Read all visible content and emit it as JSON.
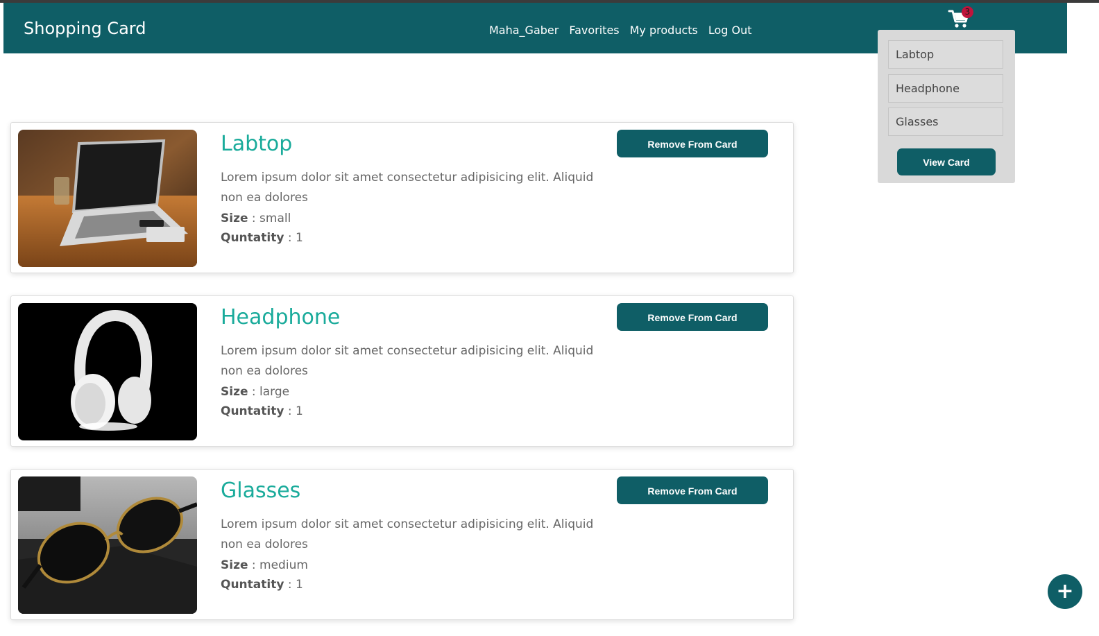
{
  "header": {
    "brand": "Shopping Card",
    "nav": [
      "Maha_Gaber",
      "Favorites",
      "My products",
      "Log Out"
    ],
    "cart_count": "3"
  },
  "cart_dropdown": {
    "items": [
      "Labtop",
      "Headphone",
      "Glasses"
    ],
    "view_card_label": "View Card"
  },
  "products": [
    {
      "title": "Labtop",
      "description": "Lorem ipsum dolor sit amet consectetur adipisicing elit. Aliquid non ea dolores",
      "size_label": "Size",
      "size": " : small",
      "quantity_label": "Quntatity",
      "quantity": " : 1",
      "remove_label": "Remove From Card"
    },
    {
      "title": "Headphone",
      "description": "Lorem ipsum dolor sit amet consectetur adipisicing elit. Aliquid non ea dolores",
      "size_label": "Size",
      "size": " : large",
      "quantity_label": "Quntatity",
      "quantity": " : 1",
      "remove_label": "Remove From Card"
    },
    {
      "title": "Glasses",
      "description": "Lorem ipsum dolor sit amet consectetur adipisicing elit. Aliquid non ea dolores",
      "size_label": "Size",
      "size": " : medium",
      "quantity_label": "Quntatity",
      "quantity": " : 1",
      "remove_label": "Remove From Card"
    }
  ],
  "fab": {
    "icon": "plus-icon",
    "glyph": "+"
  },
  "colors": {
    "primary": "#0f5e66",
    "accent": "#1aab9b",
    "badge": "#c0143c"
  }
}
